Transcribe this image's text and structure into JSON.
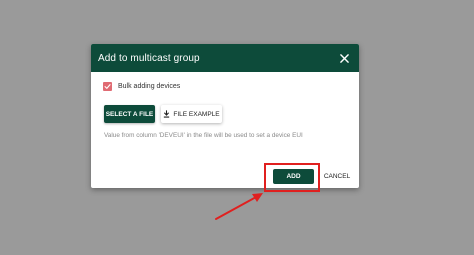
{
  "dialog": {
    "title": "Add to multicast group",
    "close_icon": "close-icon",
    "header_color": "#0d4b3a"
  },
  "bulk": {
    "label": "Bulk adding devices",
    "checked": true,
    "checkbox_color": "#e06b73"
  },
  "buttons": {
    "select_file": "SELECT A FILE",
    "file_example": "FILE EXAMPLE",
    "file_example_icon": "download-icon",
    "add": "ADD",
    "cancel": "CANCEL"
  },
  "helper_text": "Value from column 'DEVEUI' in the file will be used to set a device EUI",
  "annotation": {
    "highlight_color": "#e0201f"
  }
}
